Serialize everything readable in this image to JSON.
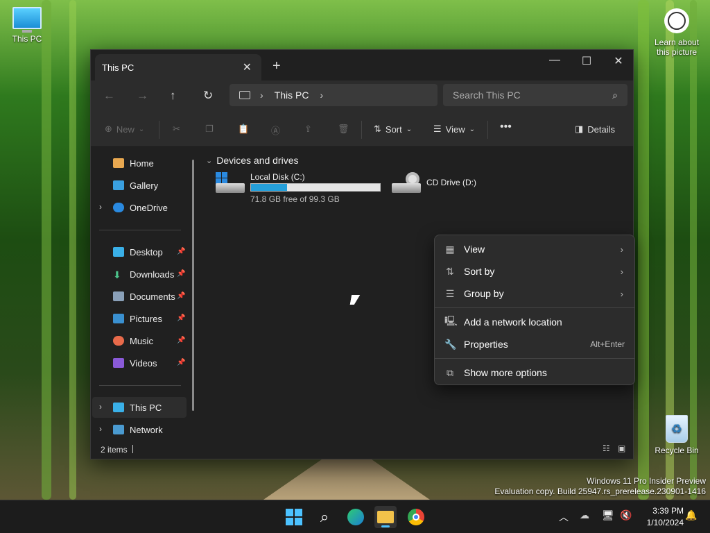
{
  "desktop": {
    "this_pc_label": "This PC",
    "learn_label_1": "Learn about",
    "learn_label_2": "this picture",
    "recycle_label": "Recycle Bin",
    "watermark_line1": "Windows 11 Pro Insider Preview",
    "watermark_line2": "Evaluation copy. Build 25947.rs_prerelease.230901-1416"
  },
  "window": {
    "tab_title": "This PC",
    "address_crumb": "This PC",
    "search_placeholder": "Search This PC",
    "toolbar": {
      "new_label": "New",
      "sort_label": "Sort",
      "view_label": "View",
      "details_label": "Details"
    },
    "sidebar": {
      "home": "Home",
      "gallery": "Gallery",
      "onedrive": "OneDrive",
      "desktop": "Desktop",
      "downloads": "Downloads",
      "documents": "Documents",
      "pictures": "Pictures",
      "music": "Music",
      "videos": "Videos",
      "this_pc": "This PC",
      "network": "Network"
    },
    "section_title": "Devices and drives",
    "drives": [
      {
        "name": "Local Disk (C:)",
        "free_text": "71.8 GB free of 99.3 GB",
        "used_fraction": 0.277
      },
      {
        "name": "CD Drive (D:)"
      }
    ],
    "status_text": "2 items"
  },
  "context_menu": {
    "view": "View",
    "sort_by": "Sort by",
    "group_by": "Group by",
    "add_network": "Add a network location",
    "properties": "Properties",
    "properties_shortcut": "Alt+Enter",
    "show_more": "Show more options"
  },
  "taskbar": {
    "time": "3:39 PM",
    "date": "1/10/2024"
  },
  "colors": {
    "accent": "#4cc2ff",
    "drive_bar": "#26a0da",
    "menu_bg": "#2c2c2c",
    "window_bg": "#202020"
  }
}
